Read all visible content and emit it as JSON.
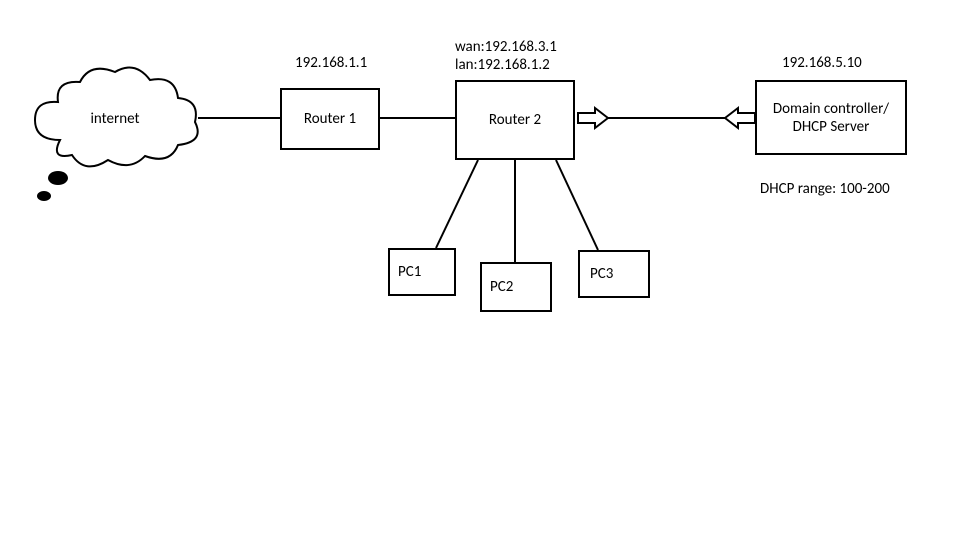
{
  "nodes": {
    "internet": {
      "label": "internet"
    },
    "router1": {
      "label": "Router 1",
      "ip": "192.168.1.1"
    },
    "router2": {
      "label": "Router 2",
      "wan": "wan:192.168.3.1",
      "lan": "lan:192.168.1.2"
    },
    "dc": {
      "label": "Domain controller/\nDHCP Server",
      "ip": "192.168.5.10",
      "dhcp_range": "DHCP range: 100-200"
    },
    "pc1": {
      "label": "PC1"
    },
    "pc2": {
      "label": "PC2"
    },
    "pc3": {
      "label": "PC3"
    }
  },
  "chart_data": {
    "type": "table",
    "title": "Network topology diagram",
    "nodes": [
      {
        "id": "internet",
        "label": "internet",
        "kind": "cloud"
      },
      {
        "id": "router1",
        "label": "Router 1",
        "kind": "router",
        "ip": "192.168.1.1"
      },
      {
        "id": "router2",
        "label": "Router 2",
        "kind": "router",
        "wan": "192.168.3.1",
        "lan": "192.168.1.2"
      },
      {
        "id": "dc",
        "label": "Domain controller/DHCP Server",
        "kind": "server",
        "ip": "192.168.5.10",
        "dhcp_range": "100-200"
      },
      {
        "id": "pc1",
        "label": "PC1",
        "kind": "pc"
      },
      {
        "id": "pc2",
        "label": "PC2",
        "kind": "pc"
      },
      {
        "id": "pc3",
        "label": "PC3",
        "kind": "pc"
      }
    ],
    "edges": [
      {
        "from": "internet",
        "to": "router1",
        "style": "line"
      },
      {
        "from": "router1",
        "to": "router2",
        "style": "line"
      },
      {
        "from": "router2",
        "to": "dc",
        "style": "double-arrow"
      },
      {
        "from": "router2",
        "to": "pc1",
        "style": "line"
      },
      {
        "from": "router2",
        "to": "pc2",
        "style": "line"
      },
      {
        "from": "router2",
        "to": "pc3",
        "style": "line"
      }
    ]
  }
}
